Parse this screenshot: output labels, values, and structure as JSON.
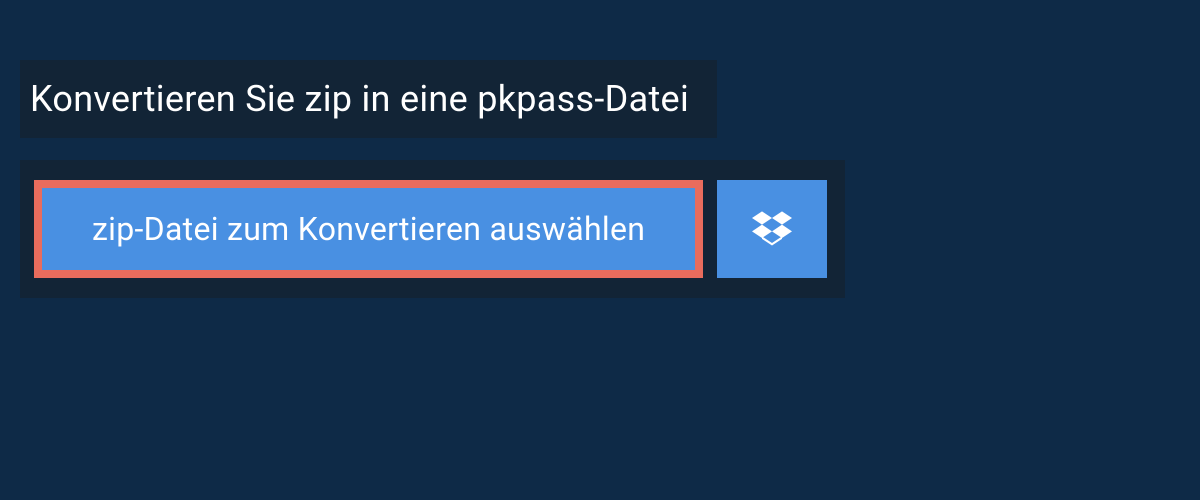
{
  "heading": "Konvertieren Sie zip in eine pkpass-Datei",
  "select_file_label": "zip-Datei zum Konvertieren auswählen",
  "colors": {
    "page_bg": "#0e2a47",
    "panel_bg": "#122436",
    "button_bg": "#4990e2",
    "highlight_border": "#e86c5d"
  }
}
